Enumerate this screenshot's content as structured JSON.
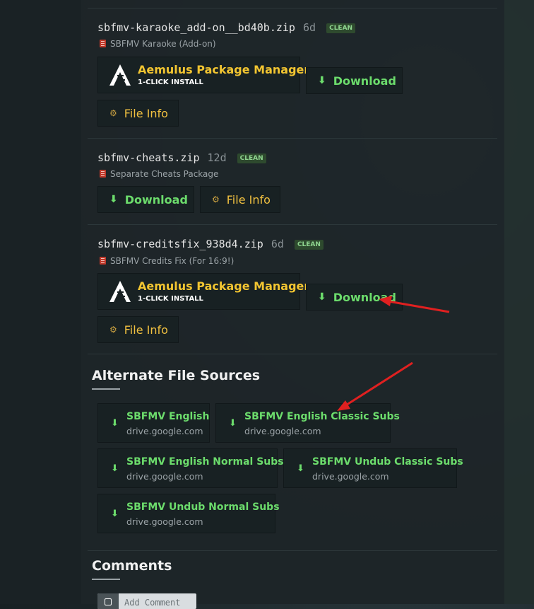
{
  "files": [
    {
      "name": "sbfmv-karaoke_add-on__bd40b.zip",
      "age": "6d",
      "badge": "CLEAN",
      "description": "SBFMV Karaoke (Add-on)",
      "aemulus": {
        "title": "Aemulus Package Manager",
        "subtitle": "1-CLICK INSTALL"
      },
      "download_label": "Download",
      "fileinfo_label": "File Info"
    },
    {
      "name": "sbfmv-cheats.zip",
      "age": "12d",
      "badge": "CLEAN",
      "description": "Separate Cheats Package",
      "download_label": "Download",
      "fileinfo_label": "File Info"
    },
    {
      "name": "sbfmv-creditsfix_938d4.zip",
      "age": "6d",
      "badge": "CLEAN",
      "description": "SBFMV Credits Fix (For 16:9!)",
      "aemulus": {
        "title": "Aemulus Package Manager",
        "subtitle": "1-CLICK INSTALL"
      },
      "download_label": "Download",
      "fileinfo_label": "File Info"
    }
  ],
  "alternate_sources": {
    "title": "Alternate File Sources",
    "items": [
      {
        "title": "SBFMV English",
        "domain": "drive.google.com"
      },
      {
        "title": "SBFMV English Classic Subs",
        "domain": "drive.google.com"
      },
      {
        "title": "SBFMV English Normal Subs",
        "domain": "drive.google.com"
      },
      {
        "title": "SBFMV Undub Classic Subs",
        "domain": "drive.google.com"
      },
      {
        "title": "SBFMV Undub Normal Subs",
        "domain": "drive.google.com"
      }
    ]
  },
  "comments": {
    "title": "Comments",
    "add_placeholder": "Add Comment"
  },
  "colors": {
    "accent_green": "#6cdc6c",
    "accent_yellow": "#f2c531",
    "annotation_red": "#e02020"
  },
  "icons": {
    "download": "down-arrow-icon",
    "file_info": "gear-icon",
    "file_type": "archive-icon",
    "aemulus": "aemulus-logo-icon",
    "comment": "comment-icon"
  }
}
